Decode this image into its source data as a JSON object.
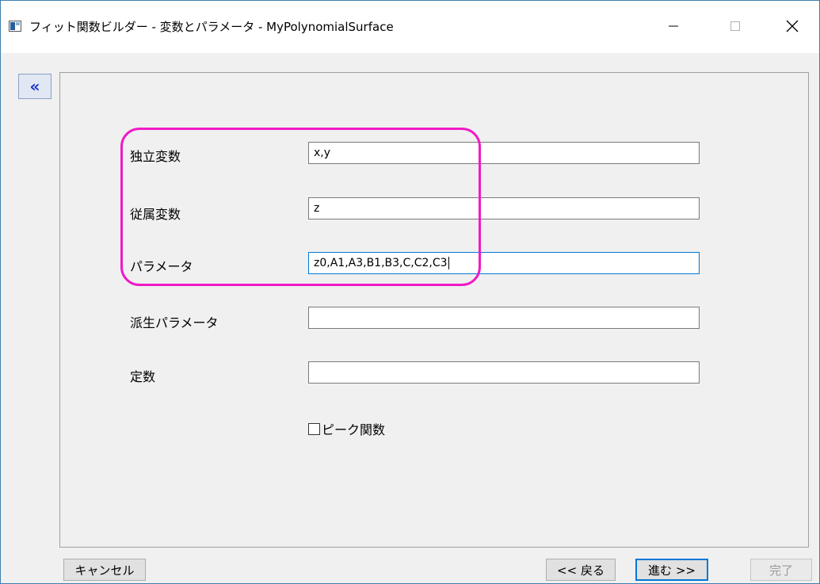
{
  "window": {
    "title": "フィット関数ビルダー - 変数とパラメータ - MyPolynomialSurface",
    "minimize_glyph": "—",
    "maximize_glyph": "☐",
    "close_glyph": "✕"
  },
  "sidebar": {
    "collapse_glyph": "«"
  },
  "form": {
    "independent": {
      "label": "独立変数",
      "value": "x,y"
    },
    "dependent": {
      "label": "従属変数",
      "value": "z"
    },
    "parameters": {
      "label": "パラメータ",
      "value": "z0,A1,A3,B1,B3,C,C2,C3"
    },
    "derived": {
      "label": "派生パラメータ",
      "value": ""
    },
    "constants": {
      "label": "定数",
      "value": ""
    },
    "peak": {
      "label": "ピーク関数",
      "checked": false
    }
  },
  "footer": {
    "cancel": "キャンセル",
    "back": "<< 戻る",
    "next": "進む >>",
    "finish": "完了"
  },
  "colors": {
    "highlight": "#f01ac8",
    "focus": "#0078d7",
    "collapse_accent": "#1a35c8"
  }
}
